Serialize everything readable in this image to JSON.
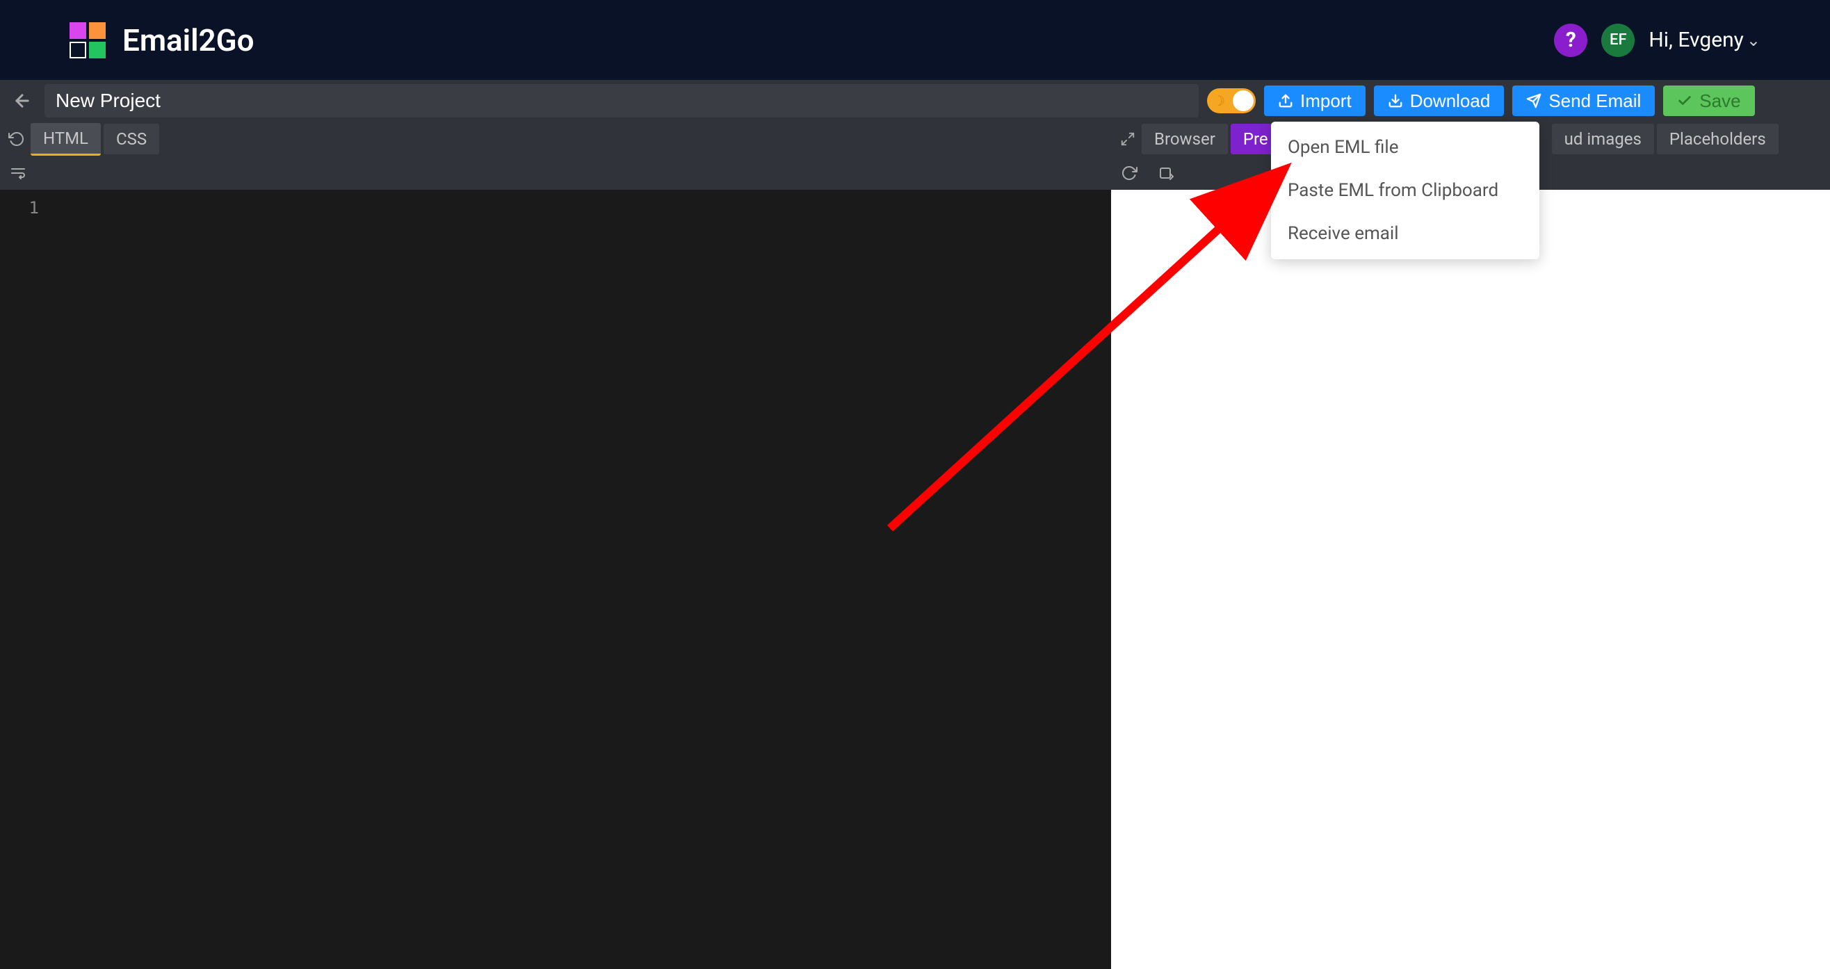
{
  "header": {
    "brand": "Email2Go",
    "help_label": "?",
    "avatar_initials": "EF",
    "greeting": "Hi, Evgeny"
  },
  "toolbar": {
    "project_title": "New Project",
    "import_label": "Import",
    "download_label": "Download",
    "send_email_label": "Send Email",
    "save_label": "Save"
  },
  "left_tabs": {
    "html": "HTML",
    "css": "CSS"
  },
  "right_tabs": {
    "browser": "Browser",
    "preview": "Pre",
    "cloud_images_partial": "ud images",
    "placeholders": "Placeholders"
  },
  "editor": {
    "line_number": "1"
  },
  "dropdown": {
    "items": [
      "Open EML file",
      "Paste EML from Clipboard",
      "Receive email"
    ]
  }
}
